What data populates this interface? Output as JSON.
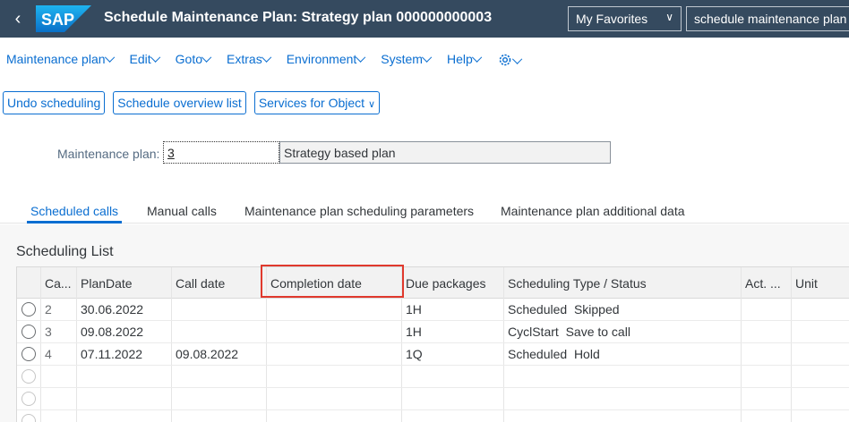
{
  "shell": {
    "title": "Schedule Maintenance Plan: Strategy plan 000000000003",
    "logo_text": "SAP",
    "favorites": "My Favorites",
    "search_value": "schedule maintenance plan"
  },
  "menu": [
    {
      "label": "Maintenance plan"
    },
    {
      "label": "Edit"
    },
    {
      "label": "Goto"
    },
    {
      "label": "Extras"
    },
    {
      "label": "Environment"
    },
    {
      "label": "System"
    },
    {
      "label": "Help"
    }
  ],
  "toolbar": {
    "undo": "Undo scheduling",
    "overview": "Schedule overview list",
    "services": "Services for Object"
  },
  "plan": {
    "label": "Maintenance plan:",
    "number": "3",
    "description": "Strategy based plan"
  },
  "tabs": [
    {
      "label": "Scheduled calls"
    },
    {
      "label": "Manual calls"
    },
    {
      "label": "Maintenance plan scheduling parameters"
    },
    {
      "label": "Maintenance plan additional data"
    }
  ],
  "list": {
    "title": "Scheduling List",
    "columns": [
      "Ca...",
      "PlanDate",
      "Call date",
      "Completion date",
      "Due packages",
      "Scheduling Type / Status",
      "Act. ...",
      "Unit"
    ],
    "rows": [
      {
        "call": "2",
        "plan_date": "30.06.2022",
        "call_date": "",
        "completion_date": "",
        "due": "1H",
        "status": "Scheduled  Skipped"
      },
      {
        "call": "3",
        "plan_date": "09.08.2022",
        "call_date": "",
        "completion_date": "",
        "due": "1H",
        "status": "CyclStart  Save to call"
      },
      {
        "call": "4",
        "plan_date": "07.11.2022",
        "call_date": "09.08.2022",
        "completion_date": "",
        "due": "1Q",
        "status": "Scheduled  Hold"
      }
    ]
  },
  "colors": {
    "shell": "#354a5f",
    "accent": "#0a6ed1",
    "highlight": "#e0392d"
  }
}
